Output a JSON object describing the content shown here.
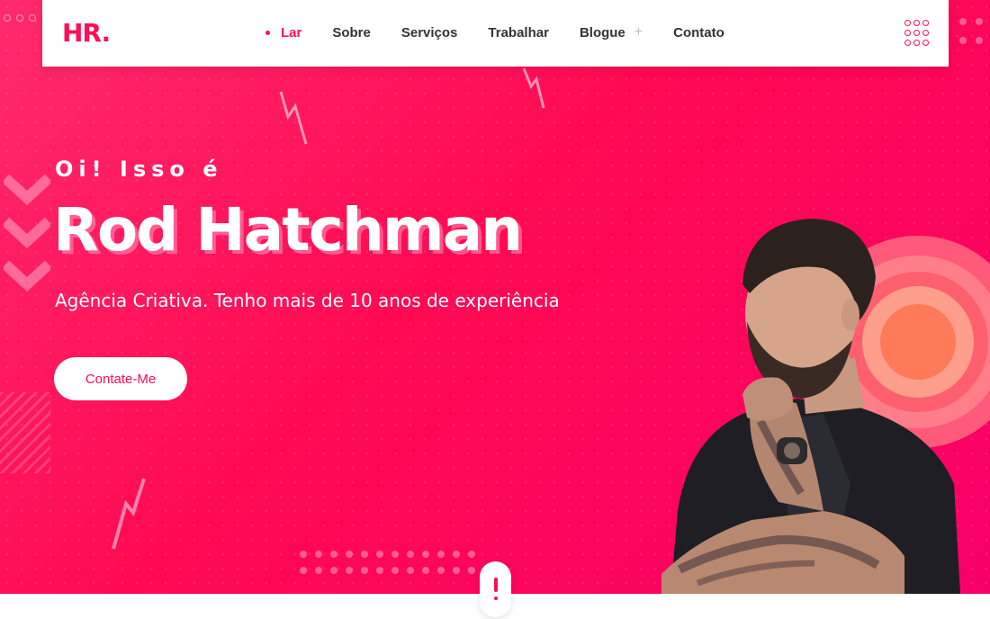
{
  "brand": {
    "logo_text": "HR.",
    "accent": "#ff0e55"
  },
  "nav": {
    "items": [
      {
        "label": "Lar",
        "active": true
      },
      {
        "label": "Sobre",
        "active": false
      },
      {
        "label": "Serviços",
        "active": false
      },
      {
        "label": "Trabalhar",
        "active": false
      },
      {
        "label": "Blogue",
        "active": false,
        "has_submenu": true
      },
      {
        "label": "Contato",
        "active": false
      }
    ],
    "plus_glyph": "+",
    "menu_icon": "dots-grid-icon"
  },
  "hero": {
    "greeting": "Oi! Isso é",
    "name": "Rod Hatchman",
    "subtitle": "Agência Criativa. Tenho mais de 10 anos de experiência",
    "cta_label": "Contate-Me",
    "background": "#ff0e55"
  },
  "scroll": {
    "icon": "scroll-indicator-icon"
  }
}
